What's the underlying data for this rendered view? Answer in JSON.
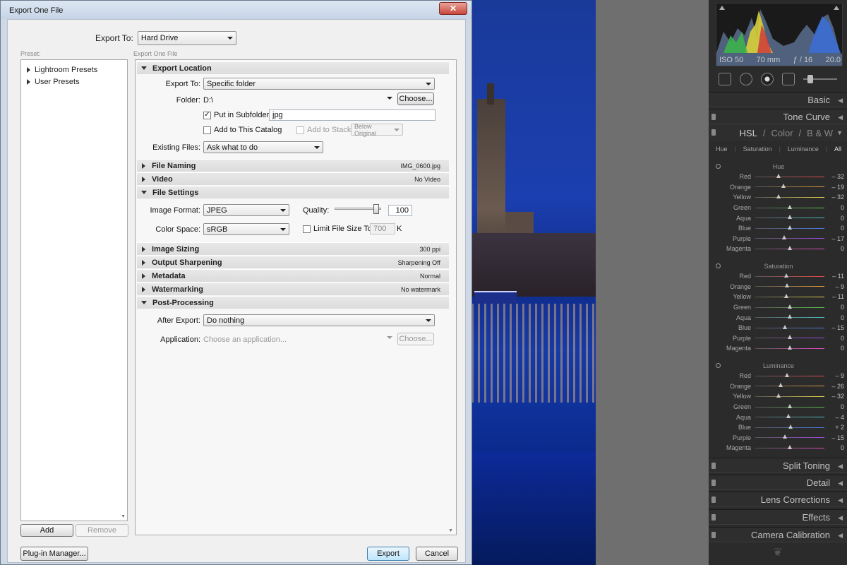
{
  "dialog": {
    "title": "Export One File",
    "close_label": "✕",
    "export_to_label": "Export To:",
    "export_to_value": "Hard Drive",
    "preset_label": "Preset:",
    "section_label": "Export One File",
    "presets": [
      {
        "label": "Lightroom Presets"
      },
      {
        "label": "User Presets"
      }
    ],
    "add_label": "Add",
    "remove_label": "Remove",
    "plugin_manager_label": "Plug-in Manager...",
    "export_label": "Export",
    "cancel_label": "Cancel"
  },
  "export_location": {
    "title": "Export Location",
    "export_to_label": "Export To:",
    "export_to_value": "Specific folder",
    "folder_label": "Folder:",
    "folder_value": "D:\\",
    "choose_label": "Choose...",
    "subfolder_label": "Put in Subfolder:",
    "subfolder_checked": true,
    "subfolder_value": "jpg",
    "add_catalog_label": "Add to This Catalog",
    "add_stack_label": "Add to Stack:",
    "stack_value": "Below Original",
    "existing_label": "Existing Files:",
    "existing_value": "Ask what to do"
  },
  "file_naming": {
    "title": "File Naming",
    "summary": "IMG_0600.jpg"
  },
  "video": {
    "title": "Video",
    "summary": "No Video"
  },
  "file_settings": {
    "title": "File Settings",
    "format_label": "Image Format:",
    "format_value": "JPEG",
    "quality_label": "Quality:",
    "quality_value": "100",
    "quality_fraction": 0.9,
    "colorspace_label": "Color Space:",
    "colorspace_value": "sRGB",
    "limit_label": "Limit File Size To:",
    "limit_value": "700",
    "limit_unit": "K"
  },
  "image_sizing": {
    "title": "Image Sizing",
    "summary": "300 ppi"
  },
  "output_sharpening": {
    "title": "Output Sharpening",
    "summary": "Sharpening Off"
  },
  "metadata": {
    "title": "Metadata",
    "summary": "Normal"
  },
  "watermarking": {
    "title": "Watermarking",
    "summary": "No watermark"
  },
  "post_processing": {
    "title": "Post-Processing",
    "after_label": "After Export:",
    "after_value": "Do nothing",
    "app_label": "Application:",
    "app_placeholder": "Choose an application...",
    "choose_label": "Choose..."
  },
  "lightroom": {
    "histogram": {
      "iso": "ISO 50",
      "focal": "70 mm",
      "aperture": "ƒ / 16",
      "shutter": "20.0"
    },
    "panels_top": [
      {
        "label": "Basic"
      },
      {
        "label": "Tone Curve"
      }
    ],
    "hsl_header": {
      "hsl": "HSL",
      "slash1": "/",
      "color": "Color",
      "slash2": "/",
      "bw": "B & W"
    },
    "hsl_tabs": {
      "hue": "Hue",
      "saturation": "Saturation",
      "luminance": "Luminance",
      "all": "All"
    },
    "groups": [
      {
        "title": "Hue",
        "rows": [
          {
            "label": "Red",
            "value": "– 32",
            "num": -32
          },
          {
            "label": "Orange",
            "value": "– 19",
            "num": -19
          },
          {
            "label": "Yellow",
            "value": "– 32",
            "num": -32
          },
          {
            "label": "Green",
            "value": "0",
            "num": 0
          },
          {
            "label": "Aqua",
            "value": "0",
            "num": 0
          },
          {
            "label": "Blue",
            "value": "0",
            "num": 0
          },
          {
            "label": "Purple",
            "value": "– 17",
            "num": -17
          },
          {
            "label": "Magenta",
            "value": "0",
            "num": 0
          }
        ]
      },
      {
        "title": "Saturation",
        "rows": [
          {
            "label": "Red",
            "value": "– 11",
            "num": -11
          },
          {
            "label": "Orange",
            "value": "– 9",
            "num": -9
          },
          {
            "label": "Yellow",
            "value": "– 11",
            "num": -11
          },
          {
            "label": "Green",
            "value": "0",
            "num": 0
          },
          {
            "label": "Aqua",
            "value": "0",
            "num": 0
          },
          {
            "label": "Blue",
            "value": "– 15",
            "num": -15
          },
          {
            "label": "Purple",
            "value": "0",
            "num": 0
          },
          {
            "label": "Magenta",
            "value": "0",
            "num": 0
          }
        ]
      },
      {
        "title": "Luminance",
        "rows": [
          {
            "label": "Red",
            "value": "– 9",
            "num": -9
          },
          {
            "label": "Orange",
            "value": "– 26",
            "num": -26
          },
          {
            "label": "Yellow",
            "value": "– 32",
            "num": -32
          },
          {
            "label": "Green",
            "value": "0",
            "num": 0
          },
          {
            "label": "Aqua",
            "value": "– 4",
            "num": -4
          },
          {
            "label": "Blue",
            "value": "+ 2",
            "num": 2
          },
          {
            "label": "Purple",
            "value": "– 15",
            "num": -15
          },
          {
            "label": "Magenta",
            "value": "0",
            "num": 0
          }
        ]
      }
    ],
    "panels_bottom": [
      {
        "label": "Split Toning"
      },
      {
        "label": "Detail"
      },
      {
        "label": "Lens Corrections"
      },
      {
        "label": "Effects"
      },
      {
        "label": "Camera Calibration"
      }
    ],
    "row_gradients": [
      "#e24a4a",
      "#e29a3a",
      "#e2d24a",
      "#5ac24a",
      "#4ac2c2",
      "#4a7ae2",
      "#a24ae2",
      "#e24ac2"
    ]
  }
}
